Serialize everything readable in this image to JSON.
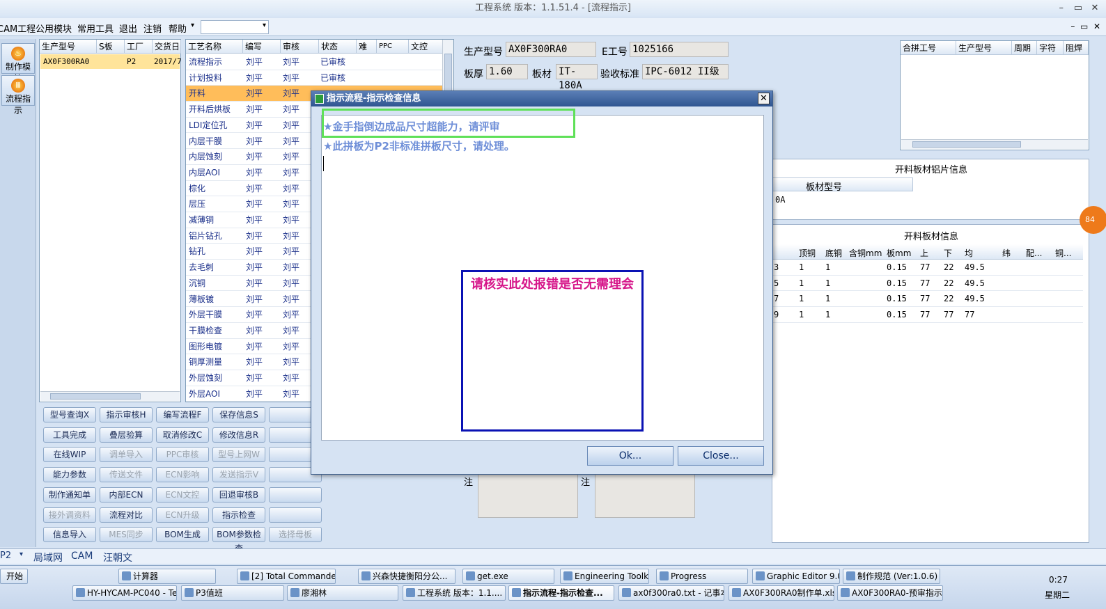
{
  "window": {
    "title": "工程系统  版本：1.1.51.4 - [流程指示]",
    "controls": [
      "–",
      "▭",
      "✕"
    ]
  },
  "menu": {
    "items": [
      "CAM工程",
      "公用模块",
      "常用工具",
      "退出",
      "注销",
      "帮助"
    ],
    "mdi_controls": [
      "–",
      "▭",
      "✕"
    ]
  },
  "leftbar": {
    "btn1": "制作模块",
    "btn2": "流程指示"
  },
  "leftgrid": {
    "headers": [
      "生产型号",
      "S板",
      "工厂",
      "交货日"
    ],
    "row": {
      "model": "AX0F300RA0",
      "factory": "P2",
      "date": "2017/7"
    }
  },
  "procgrid": {
    "headers": [
      "工艺名称",
      "编写",
      "审核",
      "状态",
      "难",
      "PPC",
      "文控"
    ],
    "rows": [
      {
        "name": "流程指示",
        "writer": "刘平",
        "reviewer": "刘平",
        "status": "已审核"
      },
      {
        "name": "计划投料",
        "writer": "刘平",
        "reviewer": "刘平",
        "status": "已审核"
      },
      {
        "name": "开料",
        "writer": "刘平",
        "reviewer": "刘平",
        "status": ""
      },
      {
        "name": "开料后烘板",
        "writer": "刘平",
        "reviewer": "刘平",
        "status": ""
      },
      {
        "name": "LDI定位孔",
        "writer": "刘平",
        "reviewer": "刘平",
        "status": ""
      },
      {
        "name": "内层干膜",
        "writer": "刘平",
        "reviewer": "刘平",
        "status": ""
      },
      {
        "name": "内层蚀刻",
        "writer": "刘平",
        "reviewer": "刘平",
        "status": ""
      },
      {
        "name": "内层AOI",
        "writer": "刘平",
        "reviewer": "刘平",
        "status": ""
      },
      {
        "name": "棕化",
        "writer": "刘平",
        "reviewer": "刘平",
        "status": ""
      },
      {
        "name": "层压",
        "writer": "刘平",
        "reviewer": "刘平",
        "status": ""
      },
      {
        "name": "减薄铜",
        "writer": "刘平",
        "reviewer": "刘平",
        "status": ""
      },
      {
        "name": "铝片钻孔",
        "writer": "刘平",
        "reviewer": "刘平",
        "status": ""
      },
      {
        "name": "钻孔",
        "writer": "刘平",
        "reviewer": "刘平",
        "status": ""
      },
      {
        "name": "去毛刺",
        "writer": "刘平",
        "reviewer": "刘平",
        "status": ""
      },
      {
        "name": "沉铜",
        "writer": "刘平",
        "reviewer": "刘平",
        "status": ""
      },
      {
        "name": "薄板镀",
        "writer": "刘平",
        "reviewer": "刘平",
        "status": ""
      },
      {
        "name": "外层干膜",
        "writer": "刘平",
        "reviewer": "刘平",
        "status": ""
      },
      {
        "name": "干膜检查",
        "writer": "刘平",
        "reviewer": "刘平",
        "status": ""
      },
      {
        "name": "图形电镀",
        "writer": "刘平",
        "reviewer": "刘平",
        "status": ""
      },
      {
        "name": "铜厚测量",
        "writer": "刘平",
        "reviewer": "刘平",
        "status": ""
      },
      {
        "name": "外层蚀刻",
        "writer": "刘平",
        "reviewer": "刘平",
        "status": ""
      },
      {
        "name": "外层AOI",
        "writer": "刘平",
        "reviewer": "刘平",
        "status": ""
      }
    ]
  },
  "buttons": {
    "r1": [
      "型号查询X",
      "指示审核H",
      "编写流程F",
      "保存信息S"
    ],
    "r2": [
      "工具完成",
      "叠层验算",
      "取消修改C",
      "修改信息R"
    ],
    "r3": [
      "在线WIP",
      "调单导入",
      "PPC审核",
      "型号上网W"
    ],
    "r4": [
      "能力参数",
      "传送文件",
      "ECN影响",
      "发送指示V"
    ],
    "r5": [
      "制作通知单",
      "内部ECN",
      "ECN文控",
      "回退审核B"
    ],
    "r6": [
      "接外调资料",
      "流程对比",
      "ECN升级",
      "指示检查"
    ],
    "r7": [
      "信息导入",
      "MES同步",
      "BOM生成",
      "BOM参数检查",
      "选择母板"
    ]
  },
  "info": {
    "model_label": "生产型号",
    "model": "AX0F300RA0",
    "eno_label": "E工号",
    "eno": "1025166",
    "thick_label": "板厚",
    "thick": "1.60",
    "mat_label": "板材",
    "mat": "IT-180A",
    "std_label": "验收标准",
    "std": "IPC-6012 II级",
    "note": "注"
  },
  "rgrid": {
    "headers": [
      "合拼工号",
      "生产型号",
      "周期",
      "字符",
      "阻焊"
    ]
  },
  "alu": {
    "title": "开料板材铝片信息",
    "header": "板材型号",
    "partial": "0A"
  },
  "mat": {
    "title": "开料板材信息",
    "headers": [
      "顶铜",
      "底铜",
      "含铜mm",
      "板mm",
      "上",
      "下",
      "均",
      "纬",
      "配...",
      "铜..."
    ],
    "rows": [
      [
        "3",
        "1",
        "1",
        "0.15",
        "77",
        "22",
        "49.5"
      ],
      [
        "5",
        "1",
        "1",
        "0.15",
        "77",
        "22",
        "49.5"
      ],
      [
        "7",
        "1",
        "1",
        "0.15",
        "77",
        "22",
        "49.5"
      ],
      [
        "9",
        "1",
        "1",
        "0.15",
        "77",
        "77",
        "77"
      ]
    ]
  },
  "dialog": {
    "title": "指示流程-指示检查信息",
    "close": "✕",
    "msg1": "★金手指倒边成品尺寸超能力，请评审",
    "msg2": "★此拼板为P2非标准拼板尺寸，请处理。",
    "notice": "请核实此处报错是否无需理会",
    "ok": "Ok...",
    "cancel": "Close..."
  },
  "statusbar": {
    "combo": "P2",
    "items": [
      "局域网",
      "CAM",
      "汪朝文"
    ]
  },
  "taskbar": {
    "start": "开始",
    "row1": [
      "计算器",
      "[2] Total Commander...",
      "兴森快捷衡阳分公...",
      "get.exe",
      "Engineering Toolkit 9...",
      "Progress",
      "Graphic Editor 9.07b...",
      "制作规范 (Ver:1.0.6)"
    ],
    "row2": [
      "HY-HYCAM-PC040 - Tea...",
      "P3值班",
      "廖湘林",
      "工程系统  版本：1.1....",
      "指示流程-指示检查...",
      "ax0f300ra0.txt - 记事本",
      "AX0F300RA0制作单.xls...",
      "AX0F300RA0-预审指示..."
    ],
    "time": "0:27",
    "day": "星期二"
  },
  "badge": "84"
}
